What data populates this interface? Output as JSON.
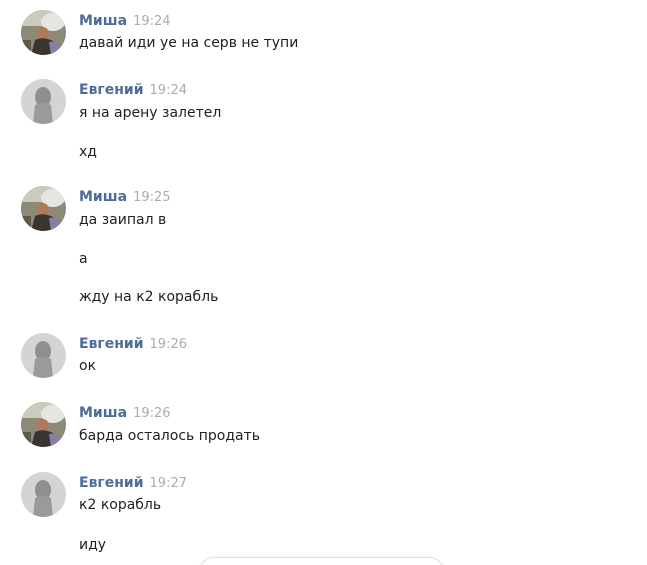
{
  "messages": [
    {
      "author": "Миша",
      "avatar": "misha-avatar",
      "time": "19:24",
      "lines": [
        "давай иди уе на серв не тупи"
      ]
    },
    {
      "author": "Евгений",
      "avatar": "evgeniy-avatar",
      "time": "19:24",
      "lines": [
        "я на арену залетел",
        "хд"
      ]
    },
    {
      "author": "Миша",
      "avatar": "misha-avatar",
      "time": "19:25",
      "lines": [
        "да заипал в",
        "а",
        "жду на к2 корабль"
      ]
    },
    {
      "author": "Евгений",
      "avatar": "evgeniy-avatar",
      "time": "19:26",
      "lines": [
        "ок"
      ]
    },
    {
      "author": "Миша",
      "avatar": "misha-avatar",
      "time": "19:26",
      "lines": [
        "барда осталось продать"
      ]
    },
    {
      "author": "Евгений",
      "avatar": "evgeniy-avatar",
      "time": "19:27",
      "lines": [
        "к2 корабль",
        "иду"
      ]
    }
  ],
  "colors": {
    "author": "#4a6e99",
    "time": "#a6adb5",
    "text": "#1f1f1f"
  }
}
